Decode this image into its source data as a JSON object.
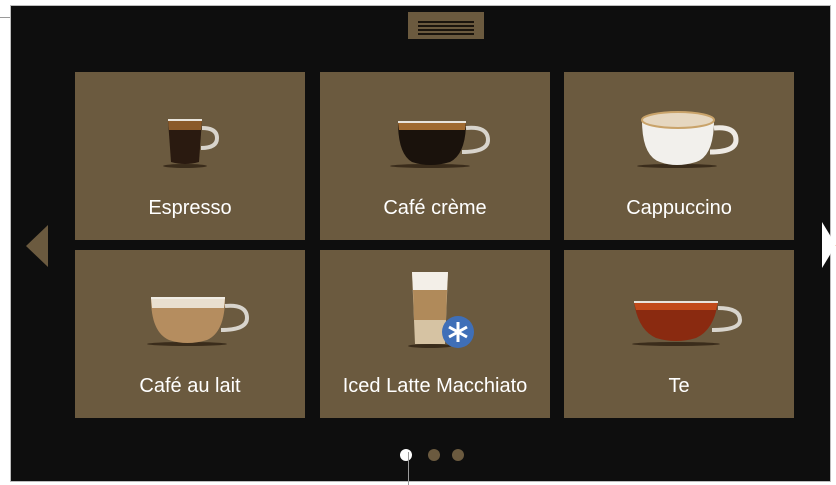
{
  "tiles": [
    {
      "label": "Espresso",
      "icon": "espresso-cup-icon"
    },
    {
      "label": "Café crème",
      "icon": "cafe-creme-cup-icon"
    },
    {
      "label": "Cappuccino",
      "icon": "cappuccino-cup-icon"
    },
    {
      "label": "Café au lait",
      "icon": "cafe-au-lait-cup-icon"
    },
    {
      "label": "Iced Latte Macchiato",
      "icon": "iced-latte-glass-icon"
    },
    {
      "label": "Te",
      "icon": "tea-cup-icon"
    }
  ],
  "pagination": {
    "current_page": 1,
    "page_count": 3
  },
  "colors": {
    "tile_bg": "#6b5a3f",
    "screen_bg": "#0e0e0e",
    "dot_active": "#ffffff",
    "dot_inactive": "#6b5a3f",
    "ice_badge": "#3f6fb8"
  }
}
